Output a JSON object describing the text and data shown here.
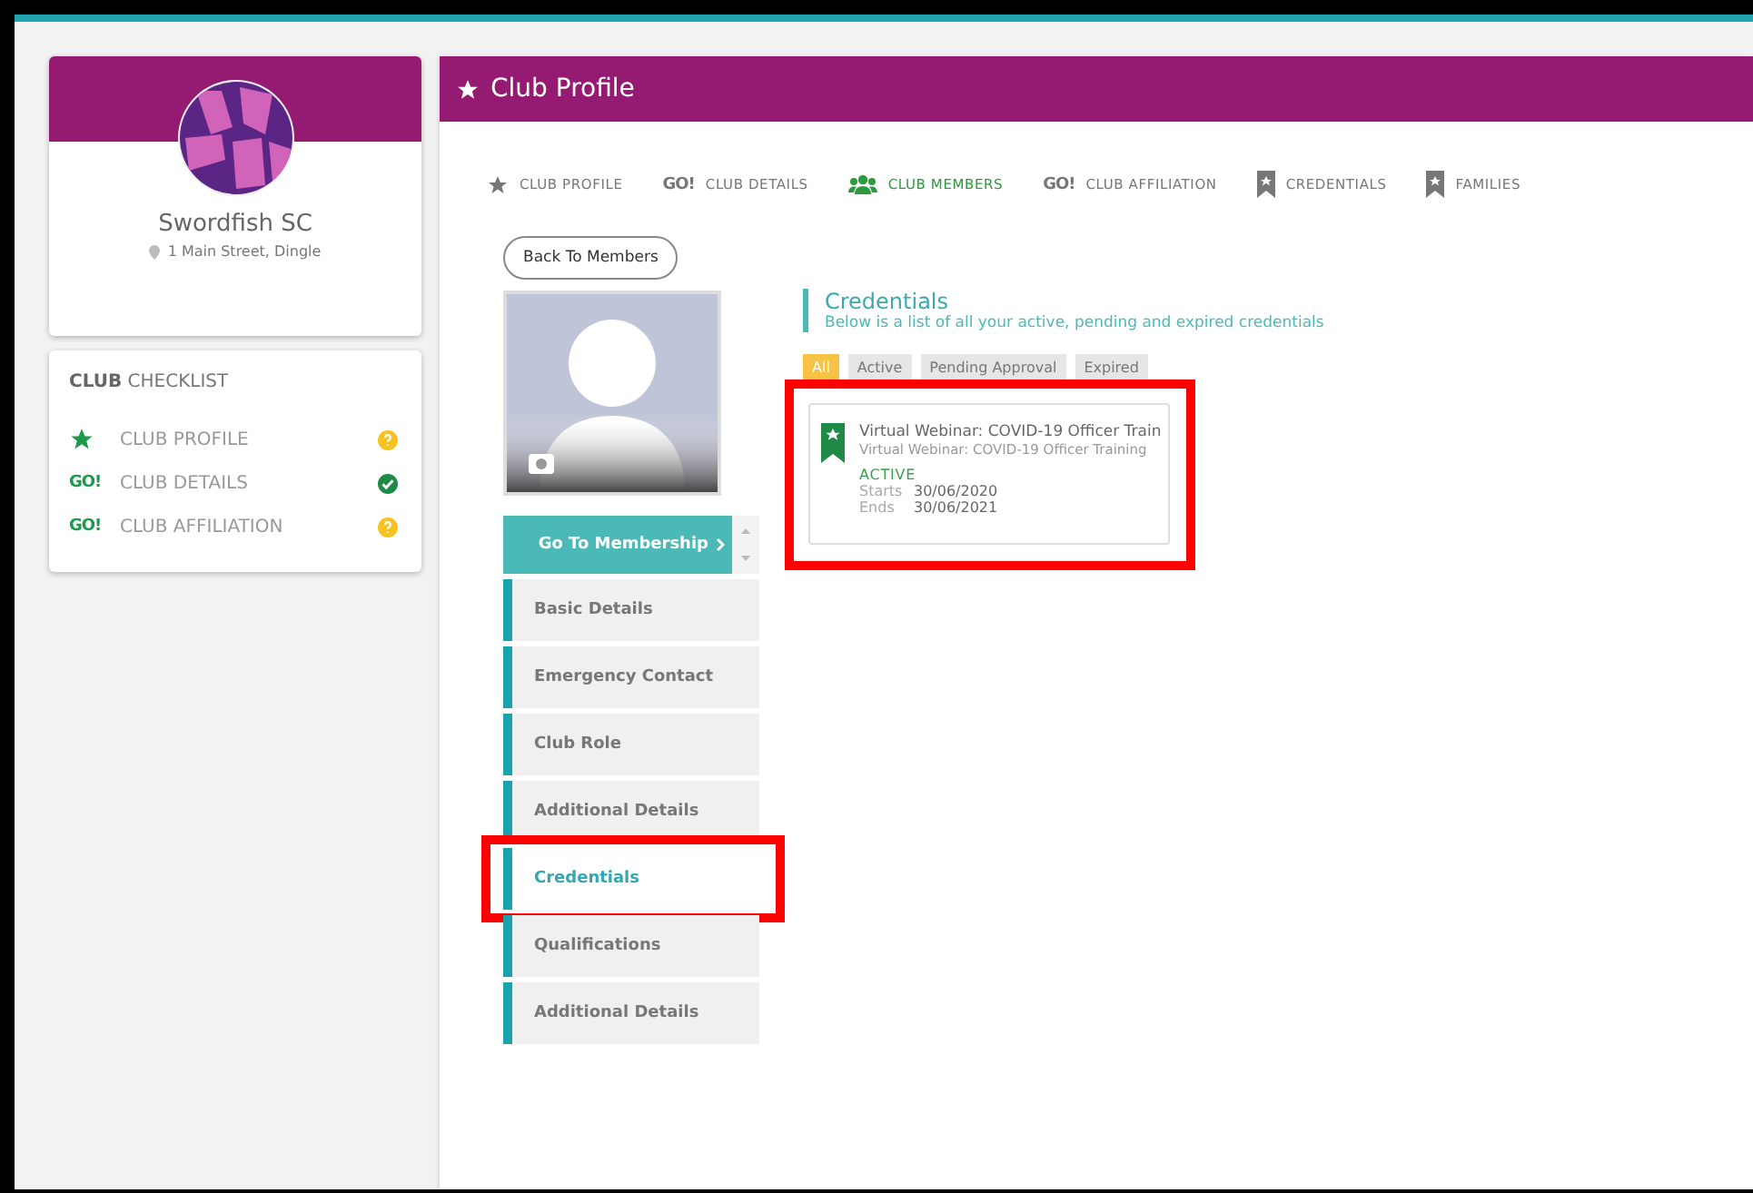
{
  "club": {
    "name": "Swordfish SC",
    "address": "1 Main Street, Dingle"
  },
  "checklist": {
    "title_bold": "CLUB",
    "title": "CHECKLIST",
    "items": [
      {
        "kind": "star",
        "label": "CLUB PROFILE",
        "done": false
      },
      {
        "kind": "go",
        "badge": "GO!",
        "label": "CLUB DETAILS",
        "done": true
      },
      {
        "kind": "go",
        "badge": "GO!",
        "label": "CLUB AFFILIATION",
        "done": false
      }
    ]
  },
  "header": {
    "title": "Club Profile"
  },
  "tabs": [
    {
      "kind": "star",
      "label": "CLUB PROFILE",
      "selected": false
    },
    {
      "kind": "go",
      "badge": "GO!",
      "label": "CLUB DETAILS",
      "selected": false
    },
    {
      "kind": "group",
      "label": "CLUB MEMBERS",
      "selected": true
    },
    {
      "kind": "go",
      "badge": "GO!",
      "label": "CLUB AFFILIATION",
      "selected": false
    },
    {
      "kind": "bookmark",
      "label": "CREDENTIALS",
      "selected": false
    },
    {
      "kind": "bookmark",
      "label": "FAMILIES",
      "selected": false
    }
  ],
  "back_button": "Back To Members",
  "membership_button": "Go To Membership",
  "member_nav": [
    {
      "label": "Basic Details",
      "selected": false,
      "highlighted": false
    },
    {
      "label": "Emergency Contact",
      "selected": false,
      "highlighted": false
    },
    {
      "label": "Club Role",
      "selected": false,
      "highlighted": false
    },
    {
      "label": "Additional Details",
      "selected": false,
      "highlighted": false
    },
    {
      "label": "Credentials",
      "selected": true,
      "highlighted": true
    },
    {
      "label": "Qualifications",
      "selected": false,
      "highlighted": false
    },
    {
      "label": "Additional Details",
      "selected": false,
      "highlighted": false
    }
  ],
  "credentials": {
    "title": "Credentials",
    "subtitle": "Below is a list of all your active, pending and expired credentials",
    "filters": [
      {
        "label": "All",
        "selected": true
      },
      {
        "label": "Active",
        "selected": false
      },
      {
        "label": "Pending Approval",
        "selected": false
      },
      {
        "label": "Expired",
        "selected": false
      }
    ],
    "cards": [
      {
        "title": "Virtual Webinar: COVID-19 Officer Train",
        "subtitle": "Virtual Webinar: COVID-19 Officer Training",
        "status": "ACTIVE",
        "starts_label": "Starts",
        "starts": "30/06/2020",
        "ends_label": "Ends",
        "ends": "30/06/2021",
        "highlighted": true
      }
    ]
  }
}
